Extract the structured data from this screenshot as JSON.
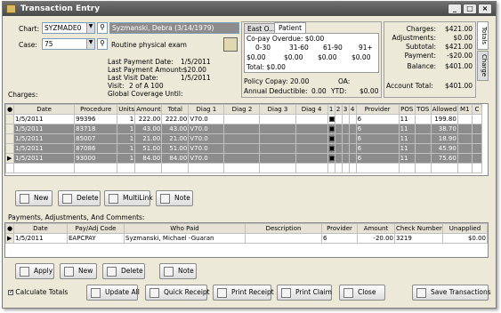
{
  "window": {
    "title": "Transaction Entry"
  },
  "header": {
    "chart_label": "Chart:",
    "chart_value": "SYZMADE0",
    "patient_name": "Syzmanski, Debra (3/14/1979)",
    "case_label": "Case:",
    "case_value": "75",
    "case_desc": "Routine physical exam",
    "charges_label": "Charges:",
    "last_payment_date_label": "Last Payment Date:",
    "last_payment_date": "1/5/2011",
    "last_payment_amount_label": "Last Payment Amount:",
    "last_payment_amount": "-$20.00",
    "last_visit_date_label": "Last Visit Date:",
    "last_visit_date": "1/5/2011",
    "visit_label": "Visit:",
    "visit_value": "2 of A 100",
    "global_coverage_label": "Global Coverage Until:"
  },
  "aging": {
    "tab_east": "East O...",
    "tab_patient": "Patient",
    "copay_overdue": "Co-pay Overdue: $0.00",
    "cols": [
      "0-30",
      "31-60",
      "61-90",
      "91+"
    ],
    "vals": [
      "$0.00",
      "$0.00",
      "$0.00",
      "$0.00"
    ],
    "total": "Total: $0.00",
    "policy_copay": "Policy Copay: 20.00",
    "oa": "OA:",
    "annual_deductible": "Annual Deductible:",
    "deductible_value": "0.00",
    "ytd": "YTD:",
    "ytd_value": "$0.00"
  },
  "totals": {
    "rows": [
      [
        "Charges:",
        "$421.00"
      ],
      [
        "Adjustments:",
        "$0.00"
      ],
      [
        "Subtotal:",
        "$421.00"
      ],
      [
        "Payment:",
        "-$20.00"
      ],
      [
        "Balance:",
        "$401.00"
      ]
    ],
    "account_total_label": "Account Total:",
    "account_total": "$401.00",
    "side_tab_totals": "Totals",
    "side_tab_charge": "Charge"
  },
  "charges_table": {
    "headers": [
      "Date",
      "Procedure",
      "Units",
      "Amount",
      "Total",
      "Diag 1",
      "Diag 2",
      "Diag 3",
      "Diag 4",
      "1",
      "2",
      "3",
      "4",
      "Provider",
      "POS",
      "TOS",
      "Allowed",
      "M1",
      "C"
    ],
    "rows": [
      {
        "date": "1/5/2011",
        "proc": "99396",
        "units": "1",
        "amount": "222.00",
        "total": "222.00",
        "diag1": "V70.0",
        "provider": "6",
        "pos": "11",
        "allowed": "199.80"
      },
      {
        "date": "1/5/2011",
        "proc": "83718",
        "units": "1",
        "amount": "43.00",
        "total": "43.00",
        "diag1": "V70.0",
        "provider": "6",
        "pos": "11",
        "allowed": "38.70"
      },
      {
        "date": "1/5/2011",
        "proc": "85007",
        "units": "1",
        "amount": "21.00",
        "total": "21.00",
        "diag1": "V70.0",
        "provider": "6",
        "pos": "11",
        "allowed": "18.90"
      },
      {
        "date": "1/5/2011",
        "proc": "87086",
        "units": "1",
        "amount": "51.00",
        "total": "51.00",
        "diag1": "V70.0",
        "provider": "6",
        "pos": "11",
        "allowed": "45.90"
      },
      {
        "date": "1/5/2011",
        "proc": "93000",
        "units": "1",
        "amount": "84.00",
        "total": "84.00",
        "diag1": "V70.0",
        "provider": "6",
        "pos": "11",
        "allowed": "75.60"
      }
    ]
  },
  "charge_buttons": {
    "new": "New",
    "delete": "Delete",
    "multilink": "MultiLink",
    "note": "Note"
  },
  "payments_section": {
    "label": "Payments, Adjustments, And Comments:",
    "headers": [
      "Date",
      "Pay/Adj Code",
      "Who Paid",
      "Description",
      "Provider",
      "Amount",
      "Check Number",
      "Unapplied"
    ],
    "rows": [
      {
        "date": "1/5/2011",
        "code": "EAPCPAY",
        "who": "Syzmanski, Michael -Guaran",
        "desc": "",
        "provider": "6",
        "amount": "-20.00",
        "check": "3219",
        "unapplied": "$0.00"
      }
    ]
  },
  "payment_buttons": {
    "apply": "Apply",
    "new": "New",
    "delete": "Delete",
    "note": "Note"
  },
  "footer": {
    "calculate_totals": "Calculate Totals",
    "update_all": "Update All",
    "quick_receipt": "Quick Receipt",
    "print_receipt": "Print Receipt",
    "print_claim": "Print Claim",
    "close": "Close",
    "save": "Save Transactions"
  }
}
